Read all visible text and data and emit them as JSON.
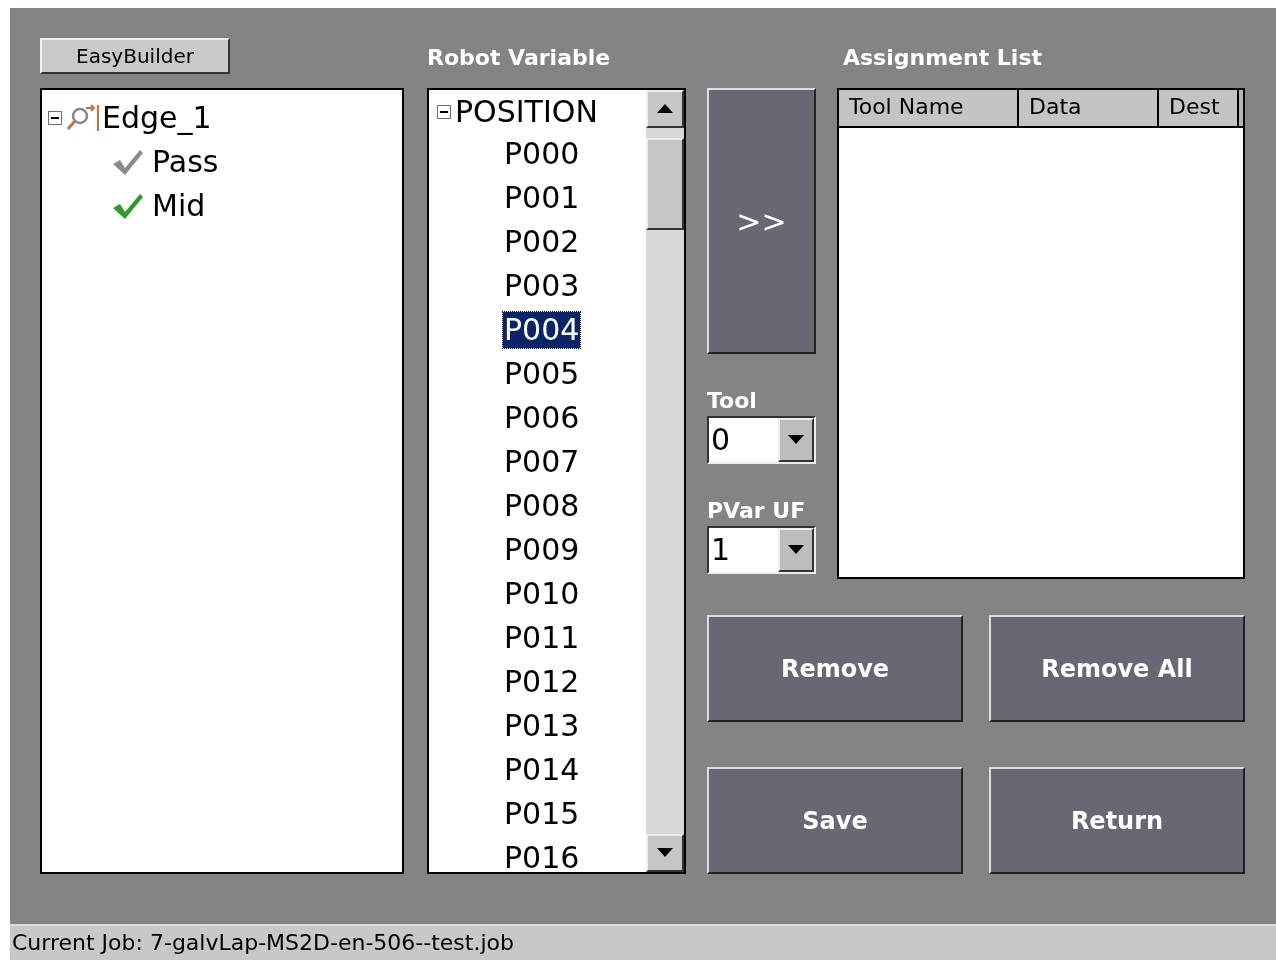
{
  "top_button": "EasyBuilder",
  "tool_tree": [
    {
      "label": "Edge_1",
      "kind": "tool",
      "expanded": true,
      "children": [
        {
          "label": "Pass",
          "kind": "check",
          "checked": false
        },
        {
          "label": "Mid",
          "kind": "check",
          "checked": true
        }
      ]
    }
  ],
  "robot_variable": {
    "title": "Robot Variable",
    "root": {
      "label": "POSITION",
      "expanded": true,
      "children": [
        {
          "label": "P000",
          "selected": false
        },
        {
          "label": "P001",
          "selected": false
        },
        {
          "label": "P002",
          "selected": false
        },
        {
          "label": "P003",
          "selected": false
        },
        {
          "label": "P004",
          "selected": true
        },
        {
          "label": "P005",
          "selected": false
        },
        {
          "label": "P006",
          "selected": false
        },
        {
          "label": "P007",
          "selected": false
        },
        {
          "label": "P008",
          "selected": false
        },
        {
          "label": "P009",
          "selected": false
        },
        {
          "label": "P010",
          "selected": false
        },
        {
          "label": "P011",
          "selected": false
        },
        {
          "label": "P012",
          "selected": false
        },
        {
          "label": "P013",
          "selected": false
        },
        {
          "label": "P014",
          "selected": false
        },
        {
          "label": "P015",
          "selected": false
        },
        {
          "label": "P016",
          "selected": false
        }
      ]
    }
  },
  "add_button": ">>",
  "tool": {
    "label": "Tool",
    "value": "0"
  },
  "pvar_uf": {
    "label": "PVar UF",
    "value": "1"
  },
  "assignment_list": {
    "title": "Assignment List",
    "columns": [
      "Tool Name",
      "Data",
      "Dest"
    ]
  },
  "buttons": [
    "Remove",
    "Remove All",
    "Save",
    "Return"
  ],
  "status_bar": "Current Job: 7-galvLap-MS2D-en-506--test.job"
}
